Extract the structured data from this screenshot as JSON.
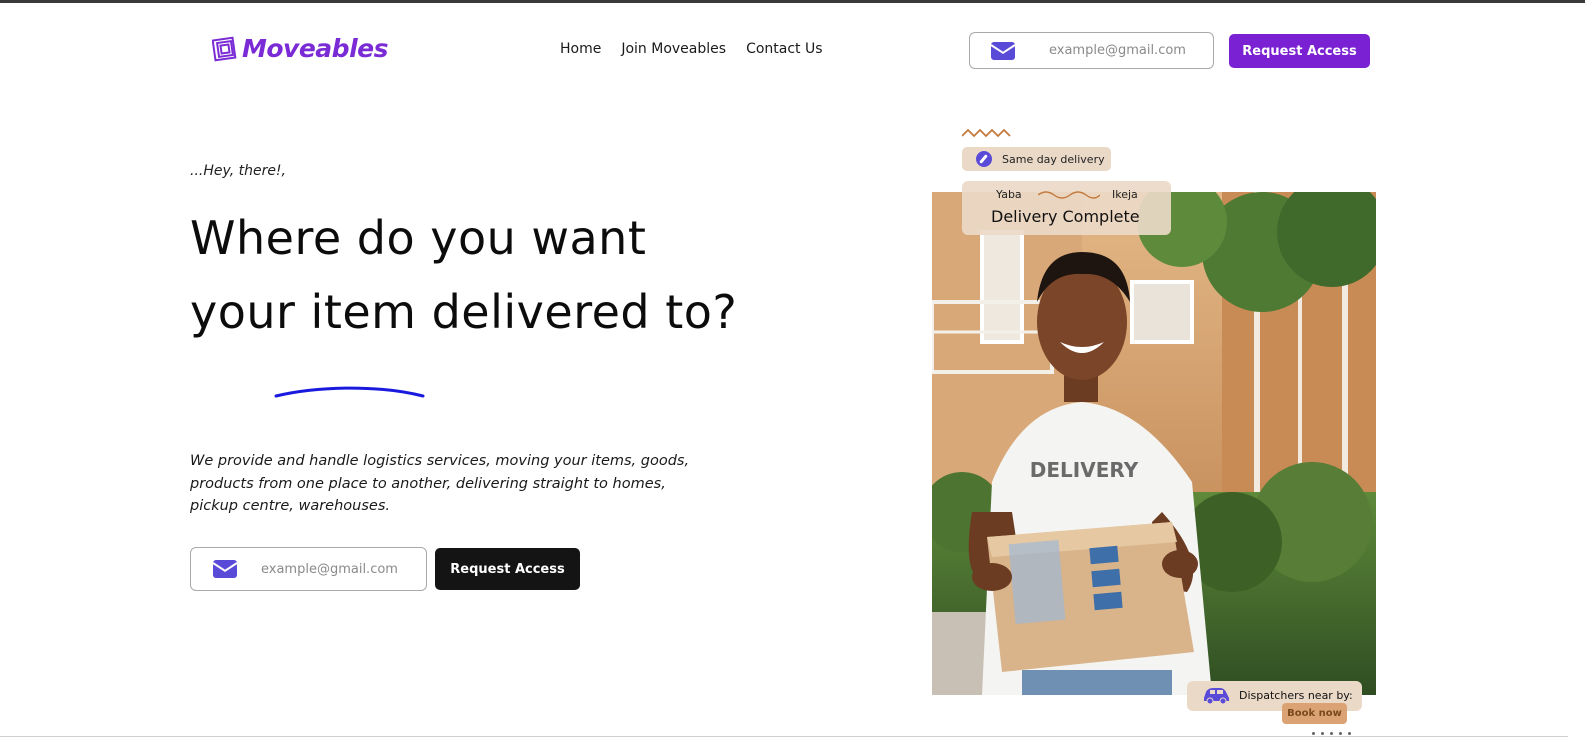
{
  "brand": {
    "name": "Moveables",
    "logo_icon": "stacked-squares-icon",
    "color": "#7a2bd6"
  },
  "nav": {
    "items": [
      "Home",
      "Join Moveables",
      "Contact Us"
    ]
  },
  "header": {
    "email_placeholder": "example@gmail.com",
    "request_label": "Request Access",
    "button_color": "#7a22d3"
  },
  "hero": {
    "greeting": "...Hey, there!,",
    "headline": "Where do you want your item delivered to?",
    "description": "We provide and handle logistics services, moving your items, goods, products from one place to another, delivering straight to homes, pickup centre, warehouses.",
    "email_placeholder": "example@gmail.com",
    "request_label": "Request Access",
    "underline_color": "#1a1adf"
  },
  "visual": {
    "chip_same_day": "Same day delivery",
    "route_from": "Yaba",
    "route_to": "Ikeja",
    "delivery_status": "Delivery Complete",
    "shirt_text": "DELIVERY",
    "dispatch_label": "Dispatchers near by:",
    "book_label": "Book now",
    "accent_color": "#5a4ad8",
    "card_color": "#ebd9c7"
  }
}
